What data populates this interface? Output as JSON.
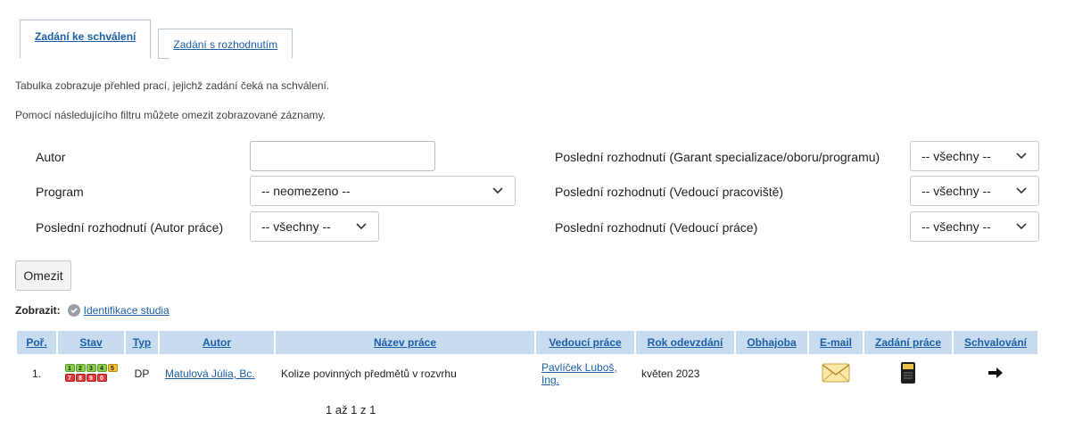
{
  "tabs": [
    {
      "label": "Zadání ke schválení",
      "active": true
    },
    {
      "label": "Zadání s rozhodnutím",
      "active": false
    }
  ],
  "info": {
    "line1": "Tabulka zobrazuje přehled prací, jejichž zadání čeká na schválení.",
    "line2": "Pomocí následujícího filtru můžete omezit zobrazované záznamy."
  },
  "filter": {
    "autor_label": "Autor",
    "autor_value": "",
    "program_label": "Program",
    "program_value": "-- neomezeno --",
    "posl_autor_label": "Poslední rozhodnutí (Autor práce)",
    "posl_autor_value": "-- všechny --",
    "posl_garant_label": "Poslední rozhodnutí (Garant specializace/oboru/programu)",
    "posl_garant_value": "-- všechny --",
    "posl_pracoviste_label": "Poslední rozhodnutí (Vedoucí pracoviště)",
    "posl_pracoviste_value": "-- všechny --",
    "posl_vedouci_label": "Poslední rozhodnutí (Vedoucí práce)",
    "posl_vedouci_value": "-- všechny --",
    "submit_label": "Omezit"
  },
  "display": {
    "label": "Zobrazit:",
    "link": "Identifikace studia"
  },
  "table": {
    "headers": [
      "Poř.",
      "Stav",
      "Typ",
      "Autor",
      "Název práce",
      "Vedoucí práce",
      "Rok odevzdání",
      "Obhajoba",
      "E-mail",
      "Zadání práce",
      "Schvalování"
    ],
    "rows": [
      {
        "poradi": "1.",
        "stav_top": [
          "1",
          "2",
          "3",
          "4",
          "5"
        ],
        "stav_bottom": [
          "7",
          "8",
          "9",
          "0"
        ],
        "typ": "DP",
        "autor": "Matulová Júlia, Bc.",
        "nazev": "Kolize povinných předmětů v rozvrhu",
        "vedouci": "Pavlíček Luboš, Ing.",
        "rok": "květen 2023",
        "obhajoba": ""
      }
    ]
  },
  "pager": "1 až 1 z 1",
  "colors": {
    "link": "#1a5fa8",
    "header_bg": "#c7dcef"
  }
}
